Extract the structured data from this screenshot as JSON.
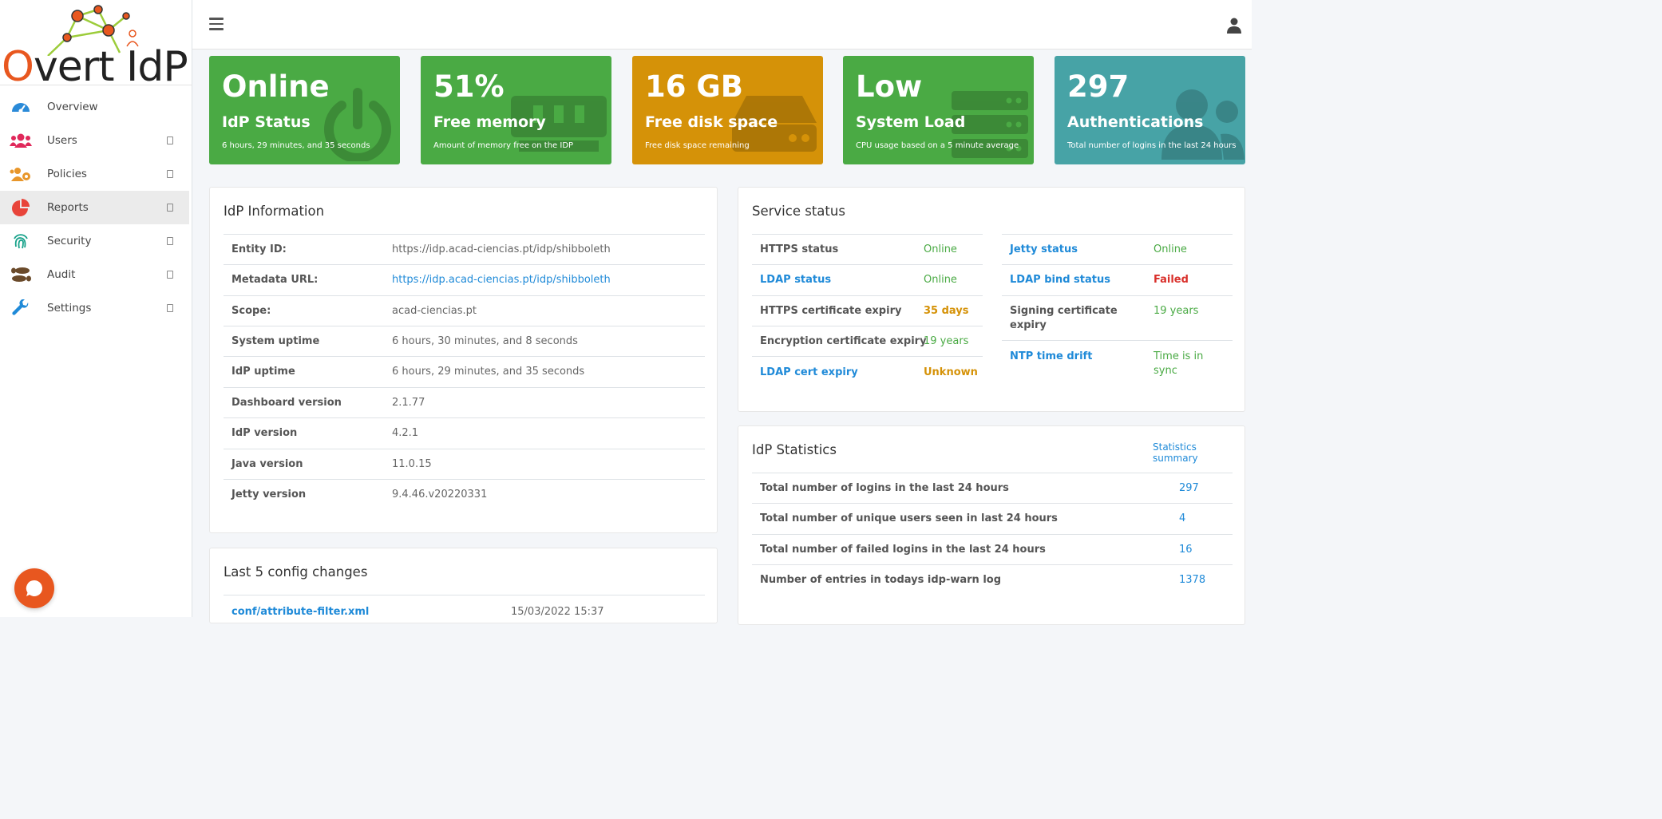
{
  "app": {
    "logo_o": "O",
    "logo_rest": "vert IdP"
  },
  "sidebar": {
    "items": [
      {
        "label": "Overview",
        "icon": "dashboard-gauge-icon",
        "color": "#2a8ad8"
      },
      {
        "label": "Users",
        "icon": "users-icon",
        "color": "#e0285a"
      },
      {
        "label": "Policies",
        "icon": "users-cog-icon",
        "color": "#e8962a"
      },
      {
        "label": "Reports",
        "icon": "pie-chart-icon",
        "color": "#e8443a"
      },
      {
        "label": "Security",
        "icon": "fingerprint-icon",
        "color": "#17a28a"
      },
      {
        "label": "Audit",
        "icon": "shoe-prints-icon",
        "color": "#6a4a2a"
      },
      {
        "label": "Settings",
        "icon": "wrench-icon",
        "color": "#1f8ad8"
      }
    ],
    "active": "Reports"
  },
  "info_boxes": [
    {
      "value": "Online",
      "title": "IdP Status",
      "subtitle": "6 hours, 29 minutes, and 35 seconds",
      "icon": "power-icon",
      "color": "#4aaa44"
    },
    {
      "value": "51%",
      "title": "Free memory",
      "subtitle": "Amount of memory free on the IDP",
      "icon": "memory-icon",
      "color": "#4aaa44"
    },
    {
      "value": "16 GB",
      "title": "Free disk space",
      "subtitle": "Free disk space remaining",
      "icon": "hdd-icon",
      "color": "#d59208"
    },
    {
      "value": "Low",
      "title": "System Load",
      "subtitle": "CPU usage based on a 5 minute average",
      "icon": "server-icon",
      "color": "#4aaa44"
    },
    {
      "value": "297",
      "title": "Authentications",
      "subtitle": "Total number of logins in the last 24 hours",
      "icon": "users-icon",
      "color": "#47a3a6"
    }
  ],
  "idp_info": {
    "title": "IdP Information",
    "rows": [
      {
        "label": "Entity ID:",
        "value": "https://idp.acad-ciencias.pt/idp/shibboleth"
      },
      {
        "label": "Metadata URL:",
        "value": "https://idp.acad-ciencias.pt/idp/shibboleth"
      },
      {
        "label": "Scope:",
        "value": "acad-ciencias.pt"
      },
      {
        "label": "System uptime",
        "value": "6 hours, 30 minutes, and 8 seconds"
      },
      {
        "label": "IdP uptime",
        "value": "6 hours, 29 minutes, and 35 seconds"
      },
      {
        "label": "Dashboard version",
        "value": "2.1.77"
      },
      {
        "label": "IdP version",
        "value": "4.2.1"
      },
      {
        "label": "Java version",
        "value": "11.0.15"
      },
      {
        "label": "Jetty version",
        "value": "9.4.46.v20220331"
      }
    ]
  },
  "config_changes": {
    "title": "Last 5 config changes",
    "rows": [
      {
        "file": "conf/attribute-filter.xml",
        "date": "15/03/2022 15:37"
      }
    ]
  },
  "service_status": {
    "title": "Service status",
    "left": [
      {
        "label": "HTTPS status",
        "value": "Online"
      },
      {
        "label": "LDAP status",
        "value": "Online"
      },
      {
        "label": "HTTPS certificate expiry",
        "value": "35 days"
      },
      {
        "label": "Encryption certificate expiry",
        "value": "19 years"
      },
      {
        "label": "LDAP cert expiry",
        "value": "Unknown"
      }
    ],
    "right": [
      {
        "label": "Jetty status",
        "value": "Online"
      },
      {
        "label": "LDAP bind status",
        "value": "Failed"
      },
      {
        "label": "Signing certificate expiry",
        "value": "19 years"
      },
      {
        "label": "NTP time drift",
        "value": "Time is in sync"
      }
    ]
  },
  "idp_stats": {
    "title": "IdP Statistics",
    "summary_link": "Statistics summary",
    "rows": [
      {
        "label": "Total number of logins in the last 24 hours",
        "value": "297"
      },
      {
        "label": "Total number of unique users seen in last 24 hours",
        "value": "4"
      },
      {
        "label": "Total number of failed logins in the last 24 hours",
        "value": "16"
      },
      {
        "label": "Number of entries in todays idp-warn log",
        "value": "1378"
      }
    ]
  }
}
